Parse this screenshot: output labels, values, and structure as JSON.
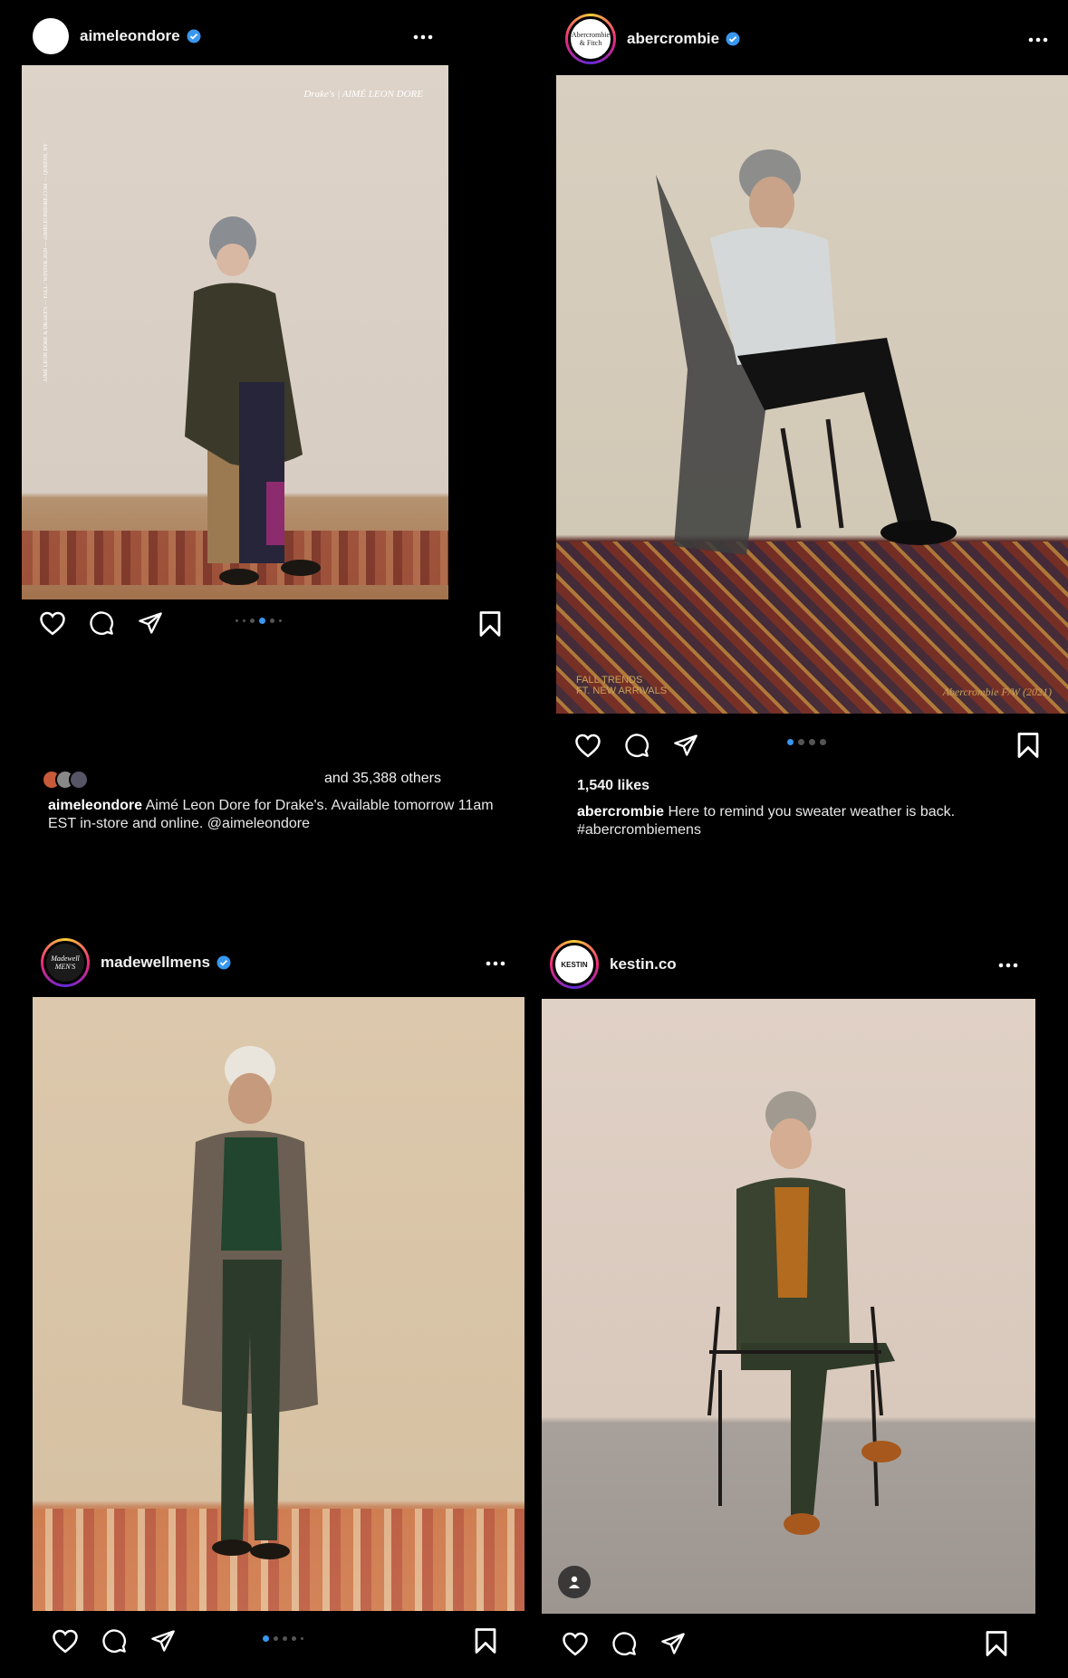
{
  "posts": [
    {
      "username": "aimeleondore",
      "verified": true,
      "photo_overlay": {
        "brand": "Drake's | AIMÉ LEON DORE",
        "vertical": "AIMÉ LEON DORE & DRAKE'S — FALL / WINTER 2020 — AIMELEONDORE.COM — QUEENS, NY"
      },
      "carousel": {
        "count": 6,
        "active": 3
      },
      "likes_text": "and 35,388 others",
      "caption_user": "aimeleondore",
      "caption_text": "Aimé Leon Dore for Drake's. Available tomorrow 11am EST in-store and online. @aimeleondore"
    },
    {
      "username": "abercrombie",
      "verified": true,
      "avatar_text": "Abercrombie & Fitch",
      "photo_overlay": {
        "left": "FALL TRENDS\nFT. NEW ARRIVALS",
        "right": "Abercrombie F/W (2021)"
      },
      "carousel": {
        "count": 4,
        "active": 0
      },
      "likes_text": "1,540 likes",
      "caption_user": "abercrombie",
      "caption_text": "Here to remind you sweater weather is back. #abercrombiemens"
    },
    {
      "username": "madewellmens",
      "verified": true,
      "avatar_text": "Madewell MEN'S",
      "carousel": {
        "count": 5,
        "active": 0
      }
    },
    {
      "username": "kestin.co",
      "verified": false,
      "avatar_text": "KESTIN"
    }
  ],
  "icons": [
    "heart-icon",
    "comment-icon",
    "share-icon",
    "bookmark-icon",
    "more-icon",
    "verified-icon",
    "user-tag-icon"
  ],
  "colors": {
    "background": "#000000",
    "verified": "#3897f0",
    "active_dot": "#3897f0"
  }
}
